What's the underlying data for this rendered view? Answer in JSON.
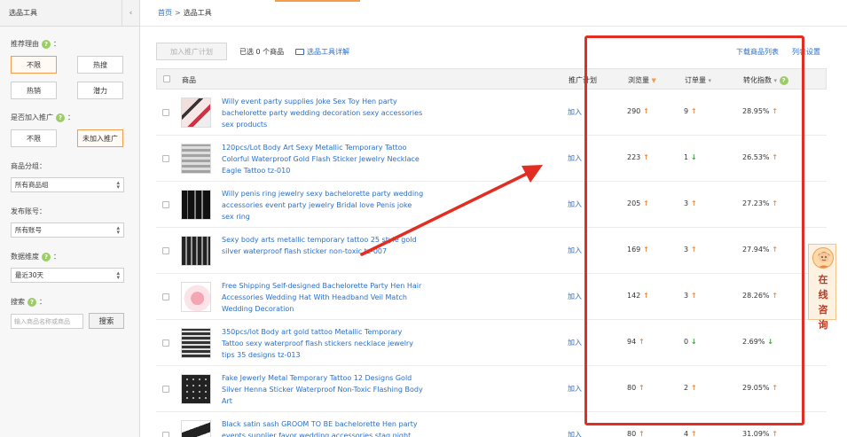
{
  "sidebar": {
    "title": "选品工具",
    "collapse_icon": "chevron-left-icon",
    "recommend_reason": {
      "label": "推荐理由",
      "options": [
        "不限",
        "热搜",
        "热销",
        "潜力"
      ],
      "selected": "不限"
    },
    "joined": {
      "label": "是否加入推广",
      "options": [
        "不限",
        "未加入推广"
      ],
      "selected": "未加入推广"
    },
    "group": {
      "label": "商品分组：",
      "value": "所有商品组"
    },
    "account": {
      "label": "发布账号：",
      "value": "所有账号"
    },
    "dimension": {
      "label": "数据维度",
      "value": "最近30天"
    },
    "search": {
      "label": "搜索",
      "placeholder": "输入商品名称或商品",
      "button": "搜索"
    }
  },
  "breadcrumb": {
    "home": "首页",
    "separator": ">",
    "current": "选品工具"
  },
  "toolbar": {
    "add_plan": "加入推广计划",
    "selected_count": "已选 0 个商品",
    "guide_link": "选品工具详解",
    "download_link": "下载商品列表",
    "column_settings": "列表设置"
  },
  "table": {
    "headers": {
      "product": "商品",
      "plan": "推广计划",
      "views": "浏览量",
      "orders": "订单量",
      "conversion": "转化指数"
    },
    "rows": [
      {
        "title": "Willy event party supplies Joke Sex Toy Hen party bachelorette party wedding decoration sexy accessories sex products",
        "plan": "加入",
        "views": "290",
        "views_trend": "up",
        "orders": "9",
        "orders_trend": "up",
        "conversion": "28.95%",
        "conversion_trend": "up"
      },
      {
        "title": "120pcs/Lot  Body Art Sexy Metallic Temporary Tattoo Colorful Waterproof Gold Flash Sticker Jewelry Necklace Eagle Tattoo tz-010",
        "plan": "加入",
        "views": "223",
        "views_trend": "up",
        "orders": "1",
        "orders_trend": "down",
        "conversion": "26.53%",
        "conversion_trend": "up"
      },
      {
        "title": "Willy penis ring jewelry sexy bachelorette party wedding accessories event party jewelry Bridal love Penis joke sex ring",
        "plan": "加入",
        "views": "205",
        "views_trend": "up",
        "orders": "3",
        "orders_trend": "up",
        "conversion": "27.23%",
        "conversion_trend": "up"
      },
      {
        "title": "Sexy body arts metallic temporary tattoo 25 style gold silver waterproof flash sticker non-toxic tz-007",
        "plan": "加入",
        "views": "169",
        "views_trend": "up",
        "orders": "3",
        "orders_trend": "up",
        "conversion": "27.94%",
        "conversion_trend": "up"
      },
      {
        "title": "Free Shipping Self-designed Bachelorette Party Hen Hair Accessories Wedding Hat With Headband Veil Match Wedding Decoration",
        "plan": "加入",
        "views": "142",
        "views_trend": "up",
        "orders": "3",
        "orders_trend": "up",
        "conversion": "28.26%",
        "conversion_trend": "up"
      },
      {
        "title": "350pcs/lot Body art gold tattoo Metallic Temporary Tattoo sexy waterproof flash stickers necklace jewelry tips 35 designs tz-013",
        "plan": "加入",
        "views": "94",
        "views_trend": "up",
        "orders": "0",
        "orders_trend": "down",
        "conversion": "2.69%",
        "conversion_trend": "down"
      },
      {
        "title": "Fake Jewerly Metal Temporary Tattoo 12 Designs Gold Silver Henna Sticker Waterproof Non-Toxic Flashing Body Art",
        "plan": "加入",
        "views": "80",
        "views_trend": "up",
        "orders": "2",
        "orders_trend": "up",
        "conversion": "29.05%",
        "conversion_trend": "up"
      },
      {
        "title": "Black satin sash GROOM TO BE bachelorette Hen party events supplier favor wedding accessories stag night",
        "plan": "加入",
        "views": "80",
        "views_trend": "up",
        "orders": "4",
        "orders_trend": "up",
        "conversion": "31.09%",
        "conversion_trend": "up"
      }
    ]
  },
  "consult_widget": {
    "text": "在线咨询"
  },
  "annotation": {
    "box_color": "#e22d22",
    "arrow_color": "#e22d22"
  },
  "colors": {
    "link": "#2a6fc9",
    "accent": "#f39c4d",
    "trend_up": "#f0893c",
    "trend_down": "#3aa33a"
  }
}
